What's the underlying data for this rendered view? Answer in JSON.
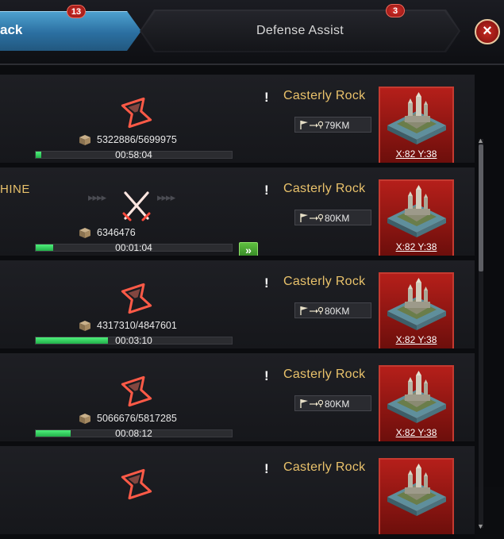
{
  "tabs": {
    "attack": {
      "label": "ack",
      "badge": "13"
    },
    "defense": {
      "label": "Defense Assist",
      "badge": "3"
    }
  },
  "close_label": "×",
  "rows": [
    {
      "name": "",
      "troops": "5322886/5699975",
      "timer": "00:58:04",
      "progress": 0.03,
      "status": "hourglass-icon",
      "location": "Casterly Rock",
      "distance": "79KM",
      "coords": "X:82 Y:38",
      "has_speedup": false
    },
    {
      "name": "HINE",
      "troops": "6346476",
      "timer": "00:01:04",
      "progress": 0.09,
      "status": "crossed-swords-icon",
      "location": "Casterly Rock",
      "distance": "80KM",
      "coords": "X:82 Y:38",
      "has_speedup": true
    },
    {
      "name": "",
      "troops": "4317310/4847601",
      "timer": "00:03:10",
      "progress": 0.37,
      "status": "hourglass-icon",
      "location": "Casterly Rock",
      "distance": "80KM",
      "coords": "X:82 Y:38",
      "has_speedup": false
    },
    {
      "name": "",
      "troops": "5066676/5817285",
      "timer": "00:08:12",
      "progress": 0.18,
      "status": "hourglass-icon",
      "location": "Casterly Rock",
      "distance": "80KM",
      "coords": "X:82 Y:38",
      "has_speedup": false
    },
    {
      "name": "",
      "troops": "",
      "timer": "",
      "progress": 0,
      "status": "hourglass-icon",
      "location": "Casterly Rock",
      "distance": "",
      "coords": "",
      "has_speedup": false
    }
  ],
  "speedup_label": "»",
  "alert_label": "!",
  "colors": {
    "accent_gold": "#e9c26b",
    "progress_green": "#2fd05a",
    "status_red": "#ff4a3c",
    "card_red": "#b51f1a"
  }
}
